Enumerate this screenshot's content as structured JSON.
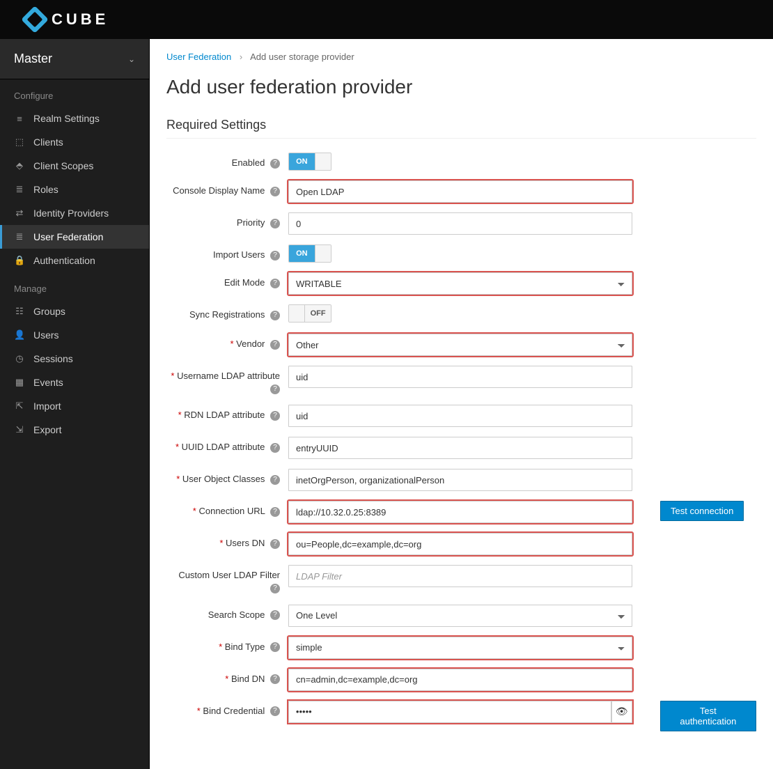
{
  "brand": "CUBE",
  "realm": "Master",
  "sidebar": {
    "section1": "Configure",
    "section2": "Manage",
    "items1": [
      {
        "icon": "≡",
        "label": "Realm Settings"
      },
      {
        "icon": "⬚",
        "label": "Clients"
      },
      {
        "icon": "⬘",
        "label": "Client Scopes"
      },
      {
        "icon": "≣",
        "label": "Roles"
      },
      {
        "icon": "⇄",
        "label": "Identity Providers"
      },
      {
        "icon": "≣",
        "label": "User Federation"
      },
      {
        "icon": "🔒",
        "label": "Authentication"
      }
    ],
    "items2": [
      {
        "icon": "☷",
        "label": "Groups"
      },
      {
        "icon": "👤",
        "label": "Users"
      },
      {
        "icon": "◷",
        "label": "Sessions"
      },
      {
        "icon": "▦",
        "label": "Events"
      },
      {
        "icon": "⇱",
        "label": "Import"
      },
      {
        "icon": "⇲",
        "label": "Export"
      }
    ]
  },
  "breadcrumb": {
    "root": "User Federation",
    "current": "Add user storage provider"
  },
  "title": "Add user federation provider",
  "section": "Required Settings",
  "labels": {
    "enabled": "Enabled",
    "consoleName": "Console Display Name",
    "priority": "Priority",
    "importUsers": "Import Users",
    "editMode": "Edit Mode",
    "syncReg": "Sync Registrations",
    "vendor": "Vendor",
    "usernameAttr": "Username LDAP attribute",
    "rdnAttr": "RDN LDAP attribute",
    "uuidAttr": "UUID LDAP attribute",
    "objClasses": "User Object Classes",
    "connUrl": "Connection URL",
    "usersDn": "Users DN",
    "customFilter": "Custom User LDAP Filter",
    "searchScope": "Search Scope",
    "bindType": "Bind Type",
    "bindDn": "Bind DN",
    "bindCred": "Bind Credential"
  },
  "toggles": {
    "on": "ON",
    "off": "OFF"
  },
  "values": {
    "consoleName": "Open LDAP",
    "priority": "0",
    "editMode": "WRITABLE",
    "vendor": "Other",
    "usernameAttr": "uid",
    "rdnAttr": "uid",
    "uuidAttr": "entryUUID",
    "objClasses": "inetOrgPerson, organizationalPerson",
    "connUrl": "ldap://10.32.0.25:8389",
    "usersDn": "ou=People,dc=example,dc=org",
    "customFilterPh": "LDAP Filter",
    "searchScope": "One Level",
    "bindType": "simple",
    "bindDn": "cn=admin,dc=example,dc=org",
    "bindCred": "•••••"
  },
  "buttons": {
    "testConn": "Test connection",
    "testAuth": "Test authentication"
  }
}
